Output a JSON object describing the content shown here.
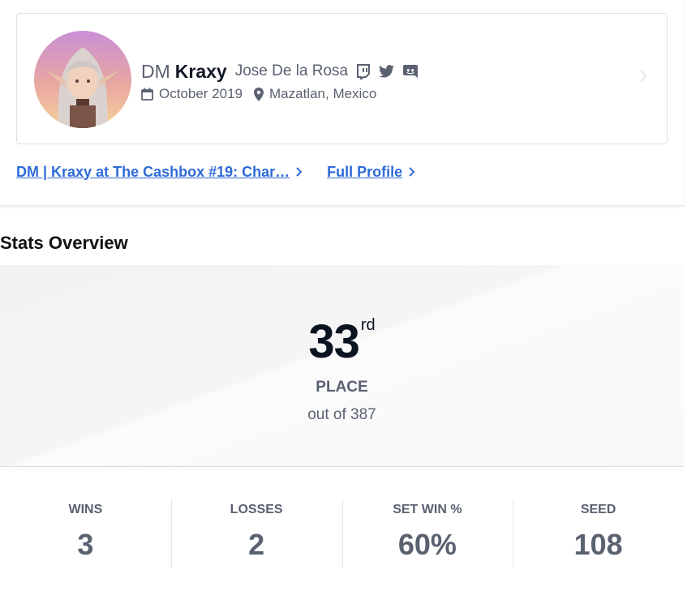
{
  "profile": {
    "prefix": "DM",
    "gamertag": "Kraxy",
    "real_name": "Jose De la Rosa",
    "social_icons": [
      "twitch-icon",
      "twitter-icon",
      "discord-icon"
    ],
    "joined": "October 2019",
    "location": "Mazatlan, Mexico"
  },
  "links": {
    "event_prefix_tag": "DM | Kraxy",
    "event_connector": " at ",
    "event_name": "The Cashbox #19: Char…",
    "full_profile": "Full Profile"
  },
  "stats_overview": {
    "title": "Stats Overview",
    "placement": "33",
    "placement_suffix": "rd",
    "placement_label": "PLACE",
    "out_of": "out of 387"
  },
  "stats": [
    {
      "label": "WINS",
      "value": "3"
    },
    {
      "label": "LOSSES",
      "value": "2"
    },
    {
      "label": "SET WIN %",
      "value": "60%"
    },
    {
      "label": "SEED",
      "value": "108"
    }
  ],
  "colors": {
    "link": "#2f6bd8",
    "muted_text": "#5a6170",
    "dark_text": "#0b1220"
  }
}
